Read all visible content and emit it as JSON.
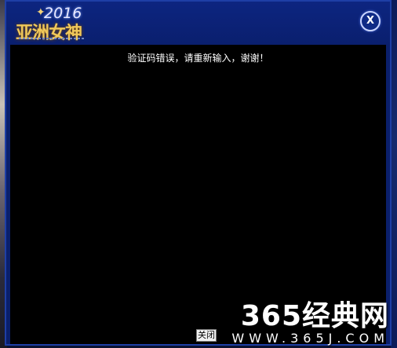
{
  "dialog": {
    "logo": {
      "year": "2016",
      "title": "亚洲女神"
    },
    "close_label": "X",
    "message": "验证码错误，请重新输入，谢谢！",
    "ok_button_label": "关闭"
  },
  "watermark": {
    "main": "365经典网",
    "url": "WWW.365J.COM"
  },
  "colors": {
    "titlebar": "#0a1f6e",
    "content_bg": "#000000",
    "accent": "#f0c85a"
  }
}
